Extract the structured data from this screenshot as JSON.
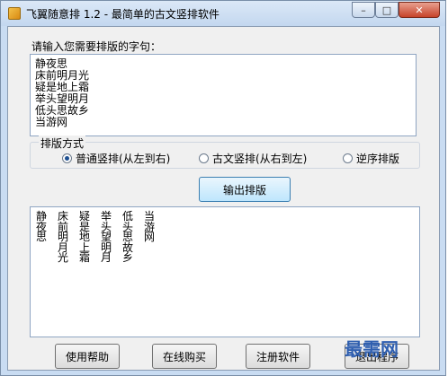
{
  "window": {
    "title": "飞翼随意排 1.2 - 最简单的古文竖排软件",
    "min_icon": "minimize-icon",
    "max_icon": "maximize-icon",
    "close_icon": "close-icon"
  },
  "prompt_label": "请输入您需要排版的字句：",
  "input_lines": [
    "静夜思",
    "床前明月光",
    "疑是地上霜",
    "举头望明月",
    "低头思故乡",
    "当游网"
  ],
  "layout_group": {
    "label": "排版方式",
    "options": [
      {
        "label": "普通竖排(从左到右)",
        "selected": true
      },
      {
        "label": "古文竖排(从右到左)",
        "selected": false
      },
      {
        "label": "逆序排版",
        "selected": false
      }
    ]
  },
  "output_button": "输出排版",
  "output_columns": [
    [
      "静",
      "夜",
      "思"
    ],
    [
      "床",
      "前",
      "明",
      "月",
      "光"
    ],
    [
      "疑",
      "是",
      "地",
      "上",
      "霜"
    ],
    [
      "举",
      "头",
      "望",
      "明",
      "月"
    ],
    [
      "低",
      "头",
      "思",
      "故",
      "乡"
    ],
    [
      "当",
      "游",
      "网"
    ]
  ],
  "bottom_buttons": {
    "help": "使用帮助",
    "buy": "在线购买",
    "register": "注册软件",
    "exit": "退出程序"
  },
  "watermark": "最需网"
}
